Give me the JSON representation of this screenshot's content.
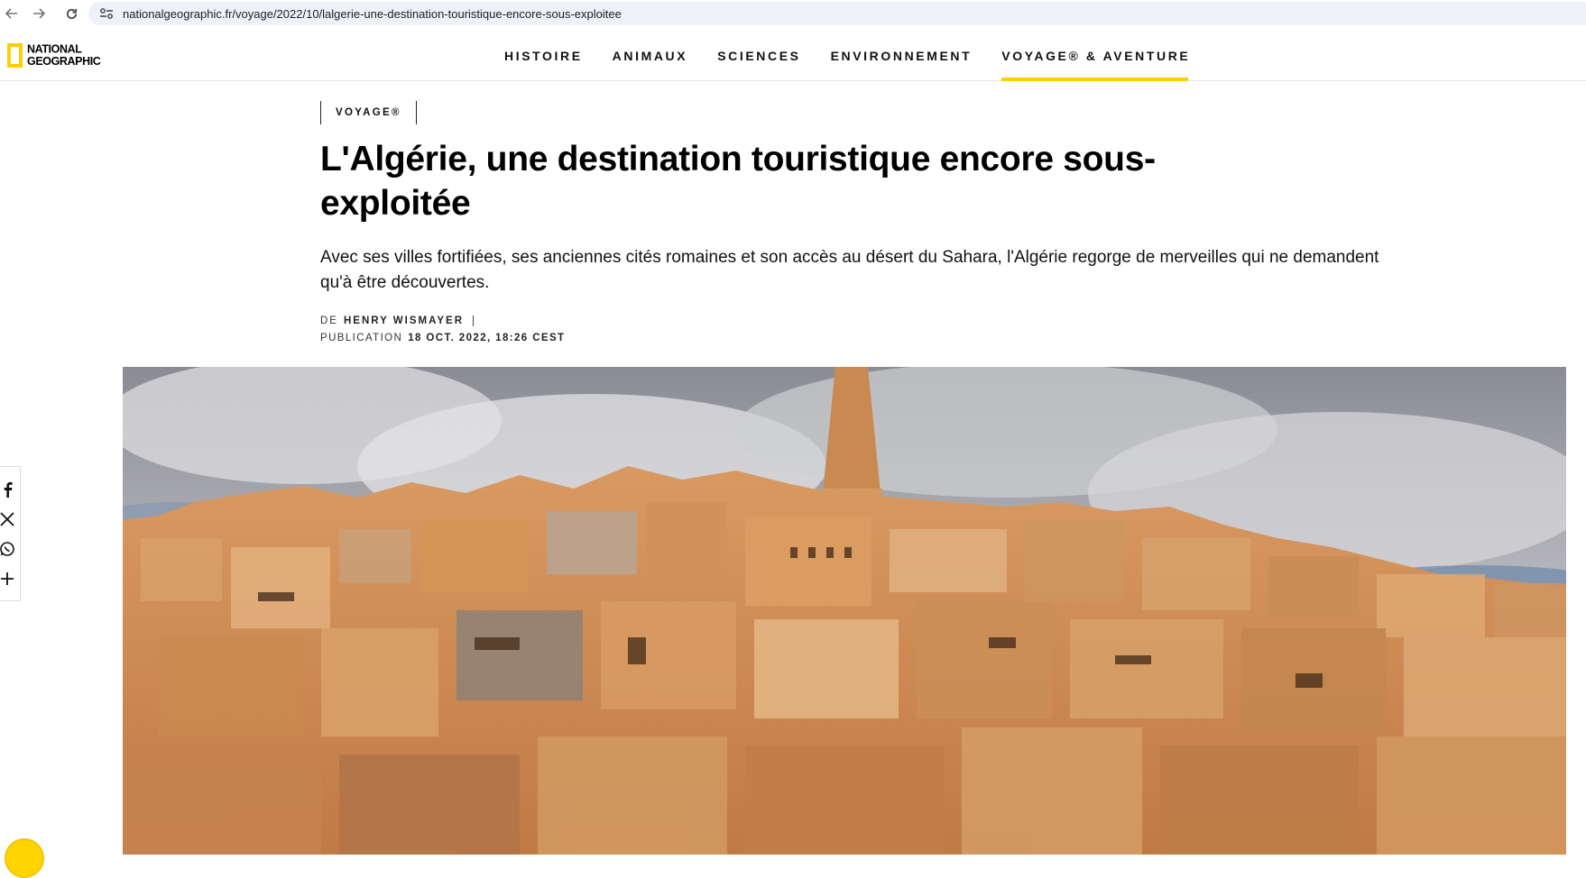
{
  "browser": {
    "url": "nationalgeographic.fr/voyage/2022/10/lalgerie-une-destination-touristique-encore-sous-exploitee"
  },
  "site": {
    "logo_line1": "NATIONAL",
    "logo_line2": "GEOGRAPHIC",
    "brand_color": "#ffce00",
    "nav": [
      {
        "label": "HISTOIRE",
        "active": false
      },
      {
        "label": "ANIMAUX",
        "active": false
      },
      {
        "label": "SCIENCES",
        "active": false
      },
      {
        "label": "ENVIRONNEMENT",
        "active": false
      },
      {
        "label": "VOYAGE® & AVENTURE",
        "active": true
      }
    ]
  },
  "article": {
    "kicker": "VOYAGE®",
    "title": "L'Algérie, une destination touristique encore sous-exploitée",
    "dek": "Avec ses villes fortifiées, ses anciennes cités romaines et son accès au désert du Sahara, l'Algérie regorge de merveilles qui ne demandent qu'à être découvertes.",
    "byline_prefix": "DE",
    "author": "HENRY WISMAYER",
    "published_label": "PUBLICATION",
    "published_date": "18 OCT. 2022, 18:26 CEST"
  },
  "share": {
    "icons": [
      "facebook-icon",
      "x-icon",
      "whatsapp-icon",
      "plus-icon"
    ]
  }
}
